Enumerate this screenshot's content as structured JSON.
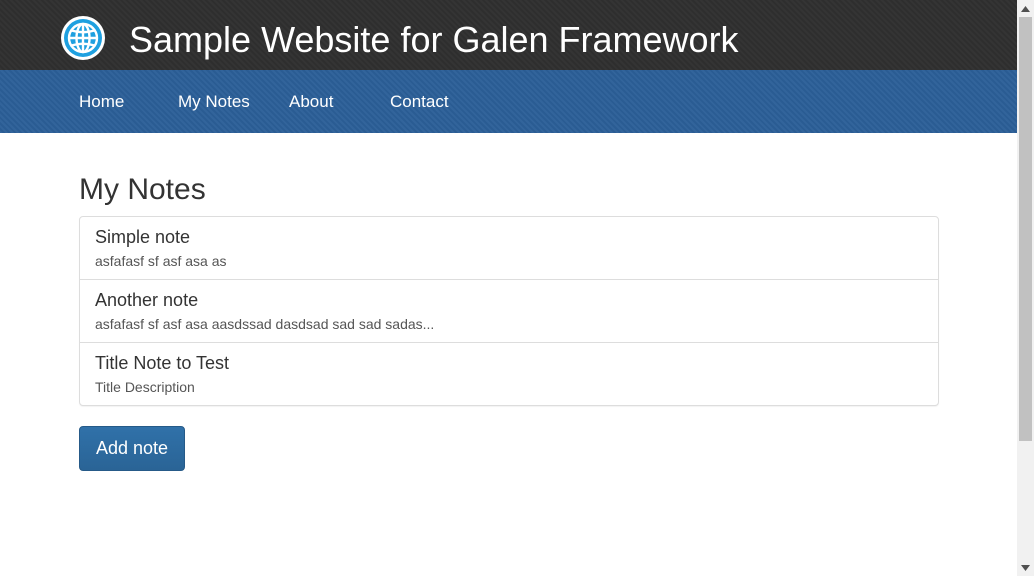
{
  "header": {
    "site_title": "Sample Website for Galen Framework",
    "logo_icon": "globe-icon",
    "logo_color": "#1ea0e0"
  },
  "nav": {
    "items": [
      {
        "label": "Home"
      },
      {
        "label": "My Notes"
      },
      {
        "label": "About"
      },
      {
        "label": "Contact"
      }
    ]
  },
  "main": {
    "title": "My Notes",
    "notes": [
      {
        "title": "Simple note",
        "description": "asfafasf sf asf asa as"
      },
      {
        "title": "Another note",
        "description": "asfafasf sf asf asa aasdssad dasdsad sad sad sadas..."
      },
      {
        "title": "Title Note to Test",
        "description": "Title Description"
      }
    ],
    "add_button_label": "Add note"
  },
  "colors": {
    "header_bg": "#2f2f2f",
    "nav_bg": "#2b5f98",
    "button_bg": "#2d6ca2"
  }
}
